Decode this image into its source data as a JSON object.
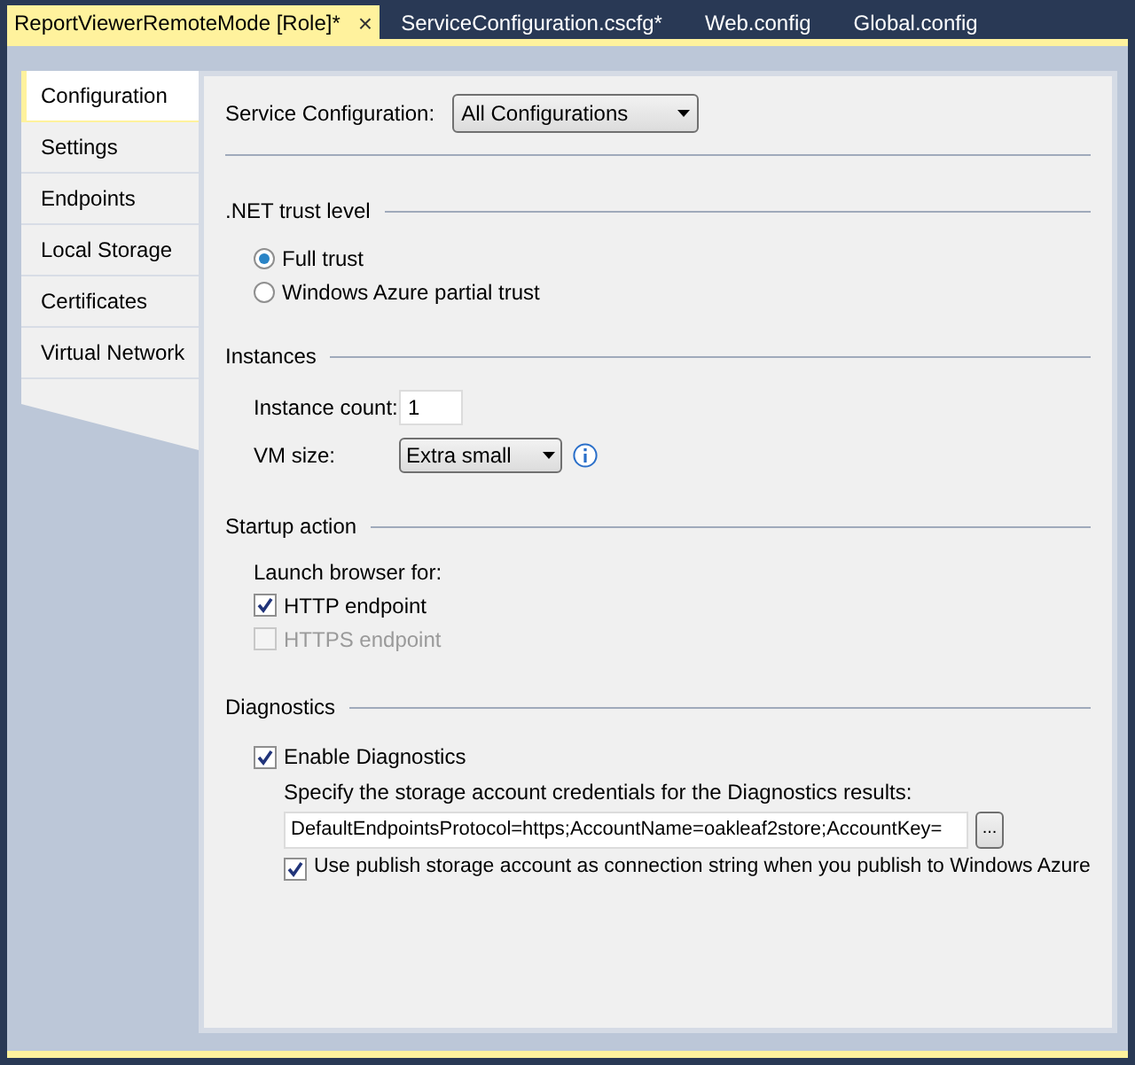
{
  "document_tabs": [
    {
      "label": "ReportViewerRemoteMode [Role]*",
      "selected": true,
      "close": "×"
    },
    {
      "label": "ServiceConfiguration.cscfg*",
      "selected": false
    },
    {
      "label": "Web.config",
      "selected": false
    },
    {
      "label": "Global.config",
      "selected": false
    }
  ],
  "side_tabs": [
    {
      "label": "Configuration",
      "selected": true
    },
    {
      "label": "Settings",
      "selected": false
    },
    {
      "label": "Endpoints",
      "selected": false
    },
    {
      "label": "Local Storage",
      "selected": false
    },
    {
      "label": "Certificates",
      "selected": false
    },
    {
      "label": "Virtual Network",
      "selected": false
    }
  ],
  "service_configuration": {
    "label": "Service Configuration:",
    "value": "All Configurations"
  },
  "trust": {
    "heading": ".NET trust level",
    "options": [
      {
        "label": "Full trust",
        "selected": true
      },
      {
        "label": "Windows Azure partial trust",
        "selected": false
      }
    ]
  },
  "instances": {
    "heading": "Instances",
    "count_label": "Instance count:",
    "count_value": "1",
    "vm_label": "VM size:",
    "vm_value": "Extra small"
  },
  "startup": {
    "heading": "Startup action",
    "prompt": "Launch browser for:",
    "options": [
      {
        "label": "HTTP endpoint",
        "checked": true,
        "disabled": false
      },
      {
        "label": "HTTPS endpoint",
        "checked": false,
        "disabled": true
      }
    ]
  },
  "diagnostics": {
    "heading": "Diagnostics",
    "enable": {
      "label": "Enable Diagnostics",
      "checked": true
    },
    "prompt": "Specify the storage account credentials for the Diagnostics results:",
    "connection_string": "DefaultEndpointsProtocol=https;AccountName=oakleaf2store;AccountKey=",
    "browse_button": "...",
    "use_publish": {
      "label": "Use publish storage account as connection string when you publish to Windows Azure",
      "checked": true
    }
  }
}
